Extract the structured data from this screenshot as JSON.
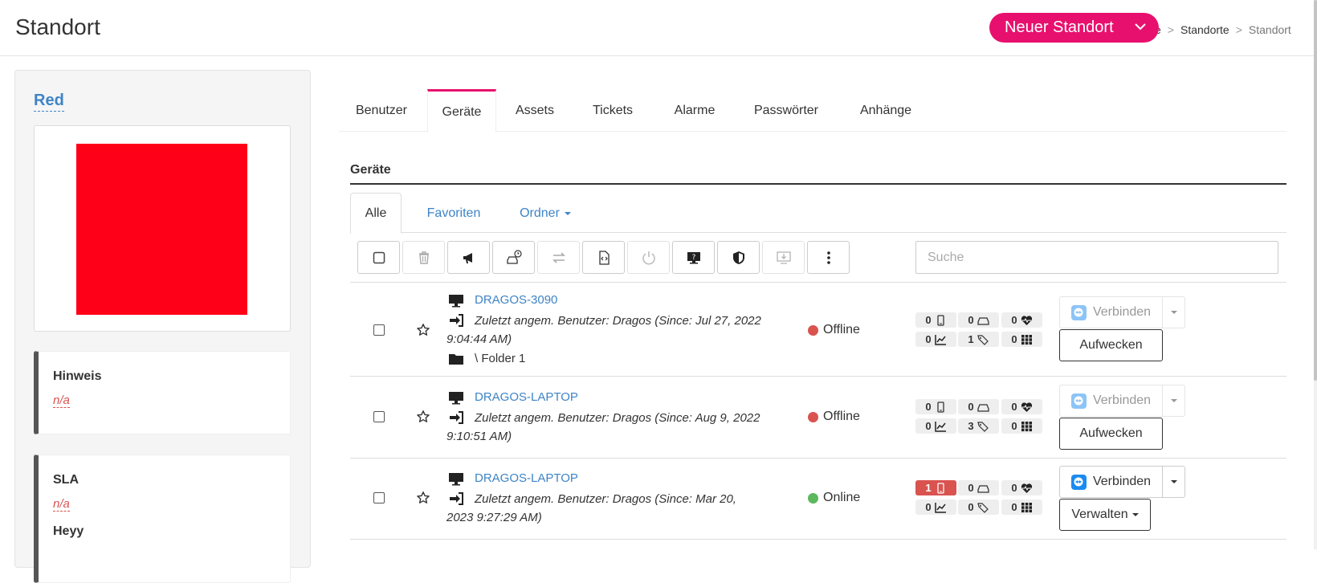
{
  "header": {
    "title": "Standort",
    "new_button": "Neuer Standort",
    "breadcrumb": [
      "e",
      "Standorte",
      "Standort"
    ],
    "breadcrumb_sep": ">"
  },
  "sidebar": {
    "name": "Red",
    "logo_color": "#ff0019",
    "hinweis_label": "Hinweis",
    "hinweis_value": "n/a",
    "sla_label": "SLA",
    "sla_value": "n/a",
    "extra_label": "Heyy"
  },
  "tabs": [
    "Benutzer",
    "Geräte",
    "Assets",
    "Tickets",
    "Alarme",
    "Passwörter",
    "Anhänge"
  ],
  "active_tab": "Geräte",
  "section": {
    "title": "Geräte"
  },
  "subtabs": {
    "all": "Alle",
    "favorites": "Favoriten",
    "folders": "Ordner"
  },
  "toolbar_icons": [
    "checkbox-icon",
    "trash-icon",
    "megaphone-icon",
    "drive-clock-icon",
    "transfer-icon",
    "script-icon",
    "power-icon",
    "monitor-question-icon",
    "shield-icon",
    "download-monitor-icon",
    "more-vertical-icon"
  ],
  "search": {
    "placeholder": "Suche"
  },
  "colors": {
    "accent": "#e8106e",
    "link": "#3e84c6",
    "offline": "#d9534f",
    "online": "#5cb85c"
  },
  "devices": [
    {
      "name": "DRAGOS-3090",
      "user_text": "Zuletzt angem. Benutzer: Dragos (Since: Jul 27, 2022 9:04:44 AM)",
      "folder": "\\ Folder 1",
      "status": "Offline",
      "badges": [
        "0",
        "0",
        "0",
        "0",
        "1",
        "0"
      ],
      "connect_label": "Verbinden",
      "action_label": "Aufwecken"
    },
    {
      "name": "DRAGOS-LAPTOP",
      "user_text": "Zuletzt angem. Benutzer: Dragos (Since: Aug 9, 2022 9:10:51 AM)",
      "status": "Offline",
      "badges": [
        "0",
        "0",
        "0",
        "0",
        "3",
        "0"
      ],
      "connect_label": "Verbinden",
      "action_label": "Aufwecken"
    },
    {
      "name": "DRAGOS-LAPTOP",
      "user_text": "Zuletzt angem. Benutzer: Dragos (Since: Mar 20, 2023 9:27:29 AM)",
      "status": "Online",
      "badges": [
        "1",
        "0",
        "0",
        "0",
        "0",
        "0"
      ],
      "connect_label": "Verbinden",
      "action_label": "Verwalten"
    }
  ]
}
